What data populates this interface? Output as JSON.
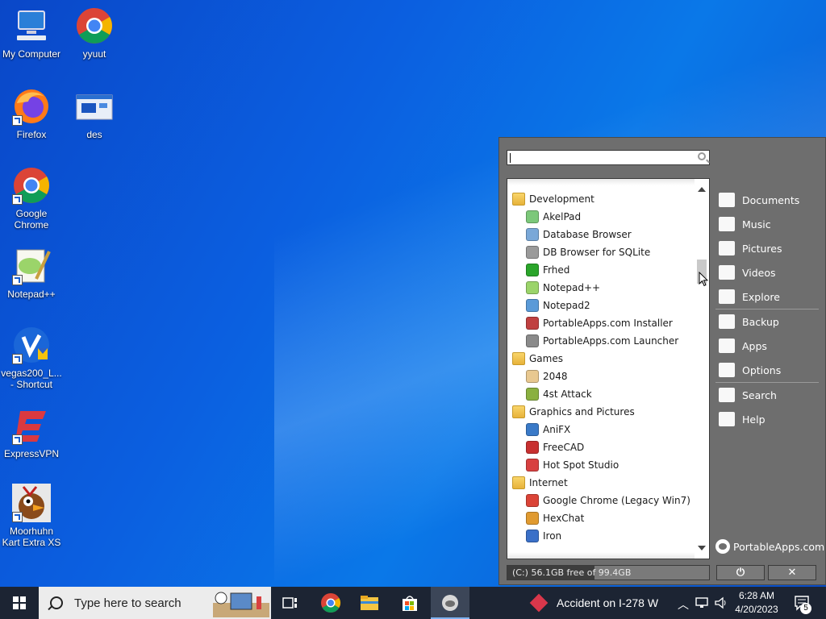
{
  "desktop": {
    "icons": [
      {
        "label": "My Computer"
      },
      {
        "label": "yyuut"
      },
      {
        "label": "Firefox"
      },
      {
        "label": "des"
      },
      {
        "label": "Google Chrome"
      },
      {
        "label": "Notepad++"
      },
      {
        "label": "vegas200_L... - Shortcut"
      },
      {
        "label": "ExpressVPN"
      },
      {
        "label": "Moorhuhn Kart Extra XS"
      }
    ]
  },
  "portableapps": {
    "search_value": "",
    "list": [
      {
        "type": "category",
        "label": "Development",
        "icon": "folder-icon"
      },
      {
        "type": "app",
        "label": "AkelPad",
        "icon": "akelpad-icon",
        "color": "#7cc87a"
      },
      {
        "type": "app",
        "label": "Database Browser",
        "icon": "database-browser-icon",
        "color": "#7aa8d8"
      },
      {
        "type": "app",
        "label": "DB Browser for SQLite",
        "icon": "sqlite-icon",
        "color": "#9a9a9a"
      },
      {
        "type": "app",
        "label": "Frhed",
        "icon": "frhed-icon",
        "color": "#2aa52a"
      },
      {
        "type": "app",
        "label": "Notepad++",
        "icon": "notepadpp-icon",
        "color": "#9bd46a"
      },
      {
        "type": "app",
        "label": "Notepad2",
        "icon": "notepad2-icon",
        "color": "#5a9ad8"
      },
      {
        "type": "app",
        "label": "PortableApps.com Installer",
        "icon": "installer-icon",
        "color": "#c04040"
      },
      {
        "type": "app",
        "label": "PortableApps.com Launcher",
        "icon": "launcher-icon",
        "color": "#8a8a8a"
      },
      {
        "type": "category",
        "label": "Games",
        "icon": "folder-icon"
      },
      {
        "type": "app",
        "label": "2048",
        "icon": "game-2048-icon",
        "color": "#e8c890"
      },
      {
        "type": "app",
        "label": "4st Attack",
        "icon": "4st-attack-icon",
        "color": "#8ab040"
      },
      {
        "type": "category",
        "label": "Graphics and Pictures",
        "icon": "folder-icon"
      },
      {
        "type": "app",
        "label": "AniFX",
        "icon": "anifx-icon",
        "color": "#3a7ac8"
      },
      {
        "type": "app",
        "label": "FreeCAD",
        "icon": "freecad-icon",
        "color": "#c83030"
      },
      {
        "type": "app",
        "label": "Hot Spot Studio",
        "icon": "hotspot-studio-icon",
        "color": "#d84040"
      },
      {
        "type": "category",
        "label": "Internet",
        "icon": "folder-icon"
      },
      {
        "type": "app",
        "label": "Google Chrome (Legacy Win7)",
        "icon": "chrome-icon",
        "color": "#db4437"
      },
      {
        "type": "app",
        "label": "HexChat",
        "icon": "hexchat-icon",
        "color": "#e09a30"
      },
      {
        "type": "app",
        "label": "Iron",
        "icon": "iron-icon",
        "color": "#3a70c8"
      }
    ],
    "right_menu": {
      "group1": [
        {
          "label": "Documents",
          "icon": "documents-icon"
        },
        {
          "label": "Music",
          "icon": "music-icon"
        },
        {
          "label": "Pictures",
          "icon": "pictures-icon"
        },
        {
          "label": "Videos",
          "icon": "videos-icon"
        },
        {
          "label": "Explore",
          "icon": "folder-icon"
        }
      ],
      "group2": [
        {
          "label": "Backup",
          "icon": "briefcase-icon"
        },
        {
          "label": "Apps",
          "icon": "apps-list-icon"
        },
        {
          "label": "Options",
          "icon": "gear-icon"
        }
      ],
      "group3": [
        {
          "label": "Search",
          "icon": "search-icon"
        },
        {
          "label": "Help",
          "icon": "help-icon"
        }
      ]
    },
    "brand": "PortableApps.com",
    "disk_text": "(C:) 56.1GB free of 99.4GB",
    "disk_used_fraction": 0.43,
    "power_glyph": "⏻",
    "close_glyph": "✕"
  },
  "taskbar": {
    "search_placeholder": "Type here to search",
    "news": "Accident on I-278 W",
    "time": "6:28 AM",
    "date": "4/20/2023",
    "notification_count": "5"
  }
}
